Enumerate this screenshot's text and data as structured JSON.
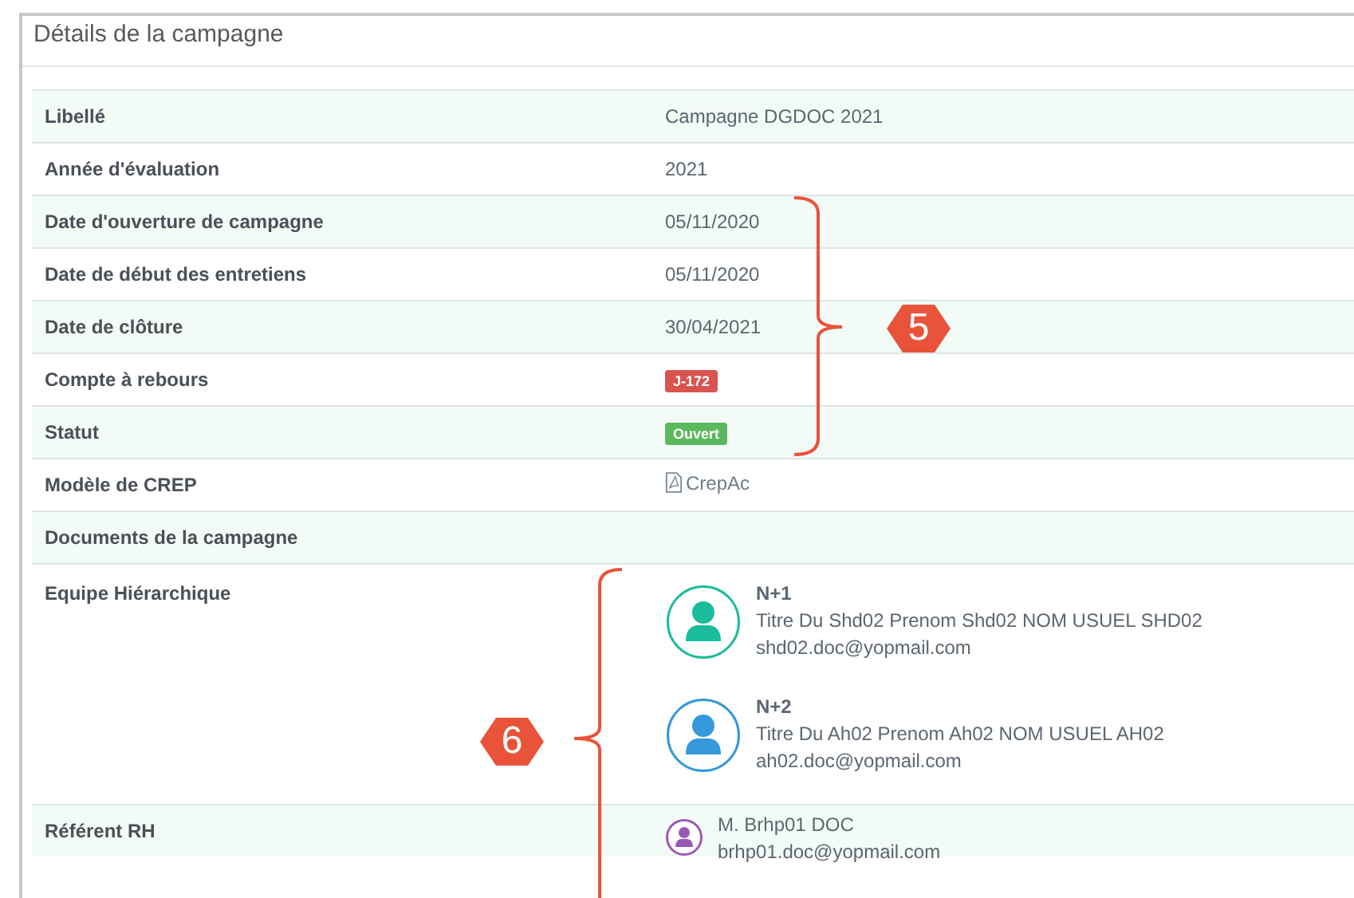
{
  "panel": {
    "title": "Détails de la campagne"
  },
  "rows": [
    {
      "label": "Libellé",
      "kind": "text",
      "value": "Campagne DGDOC 2021"
    },
    {
      "label": "Année d'évaluation",
      "kind": "text",
      "value": "2021"
    },
    {
      "label": "Date d'ouverture de campagne",
      "kind": "text",
      "value": "05/11/2020"
    },
    {
      "label": "Date de début des entretiens",
      "kind": "text",
      "value": "05/11/2020"
    },
    {
      "label": "Date de clôture",
      "kind": "text",
      "value": "30/04/2021"
    },
    {
      "label": "Compte à rebours",
      "kind": "badge",
      "value": "J-172",
      "color": "#d9534f"
    },
    {
      "label": "Statut",
      "kind": "badge",
      "value": "Ouvert",
      "color": "#5cb85c"
    },
    {
      "label": "Modèle de CREP",
      "kind": "file",
      "value": "CrepAc"
    },
    {
      "label": "Documents de la campagne",
      "kind": "empty"
    },
    {
      "label": "Equipe Hiérarchique",
      "kind": "people",
      "people": [
        {
          "role": "N+1",
          "name": "Titre Du Shd02 Prenom Shd02 NOM USUEL SHD02",
          "email": "shd02.doc@yopmail.com",
          "color": "#1abc9c"
        },
        {
          "role": "N+2",
          "name": "Titre Du Ah02 Prenom Ah02 NOM USUEL AH02",
          "email": "ah02.doc@yopmail.com",
          "color": "#3498db"
        }
      ]
    },
    {
      "label": "Référent RH",
      "kind": "contact",
      "people": [
        {
          "name": "M. Brhp01 DOC",
          "email": "brhp01.doc@yopmail.com",
          "color": "#9b59b6"
        }
      ]
    }
  ],
  "annotations": [
    {
      "label": "5"
    },
    {
      "label": "6"
    }
  ]
}
